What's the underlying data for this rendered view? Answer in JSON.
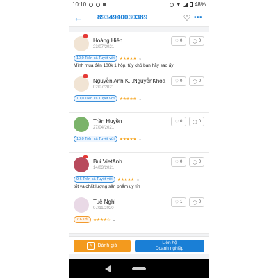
{
  "status": {
    "time": "10:10",
    "battery": "48%"
  },
  "appbar": {
    "title": "8934940030389"
  },
  "reviews": [
    {
      "name": "Hoàng Hiền",
      "date": "23/07/2021",
      "rating_label": "10,0 Trên cả Tuyệt vời",
      "stars": "★★★★★",
      "likes": "0",
      "comments": "0",
      "comment": "Mình mua đến 100k 1 hộp. tùy chỗ bạn hãy sao ấy",
      "badge_style": "blue"
    },
    {
      "name": "Nguyễn Anh K...NguyễnKhoa",
      "date": "02/07/2021",
      "rating_label": "10,0 Trên cả Tuyệt vời",
      "stars": "★★★★★",
      "likes": "0",
      "comments": "0",
      "comment": "",
      "badge_style": "blue"
    },
    {
      "name": "Trần Huyền",
      "date": "27/04/2021",
      "rating_label": "10,0 Trên cả Tuyệt vời",
      "stars": "★★★★★",
      "likes": "0",
      "comments": "0",
      "comment": "",
      "badge_style": "blue"
    },
    {
      "name": "Bui VietAnh",
      "date": "14/03/2021",
      "rating_label": "9,6 Trên cả Tuyệt vời",
      "stars": "★★★★★",
      "likes": "0",
      "comments": "0",
      "comment": "tốt và chất lượng sản phẩm uy tín",
      "badge_style": "blue"
    },
    {
      "name": "Tuệ Nghi",
      "date": "07/11/2020",
      "rating_label": "7,6 Tốt",
      "stars": "★★★★☆",
      "likes": "1",
      "comments": "0",
      "comment": "",
      "badge_style": "orange"
    }
  ],
  "bottom": {
    "rate_label": "Đánh giá",
    "contact_line1": "Liên hệ",
    "contact_line2": "Doanh nghiệp"
  },
  "colors": {
    "accent": "#1a7fd6",
    "orange": "#f39a1e"
  }
}
